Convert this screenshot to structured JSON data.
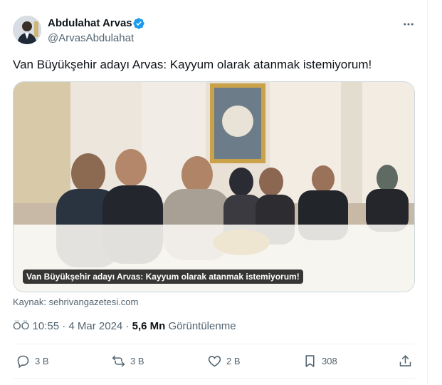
{
  "author": {
    "display_name": "Abdulahat Arvas",
    "handle": "@ArvasAbdulahat"
  },
  "tweet": {
    "text": "Van Büyükşehir adayı Arvas: Kayyum olarak atanmak istemiyorum!",
    "media_caption": "Van Büyükşehir adayı Arvas: Kayyum olarak atanmak istemiyorum!",
    "source": "Kaynak: sehrivangazetesi.com",
    "time": "ÖÖ 10:55",
    "date": "4 Mar 2024",
    "views_count": "5,6 Mn",
    "views_label": "Görüntülenme",
    "sep1": " · ",
    "sep2": " · "
  },
  "actions": {
    "replies": "3 B",
    "reposts": "3 B",
    "likes": "2 B",
    "bookmarks": "308"
  },
  "colors": {
    "verified": "#1d9bf0",
    "muted": "#536471",
    "text": "#0f1419"
  },
  "icons": [
    "more-icon",
    "verified-icon",
    "reply-icon",
    "repost-icon",
    "like-icon",
    "bookmark-icon",
    "share-icon"
  ]
}
